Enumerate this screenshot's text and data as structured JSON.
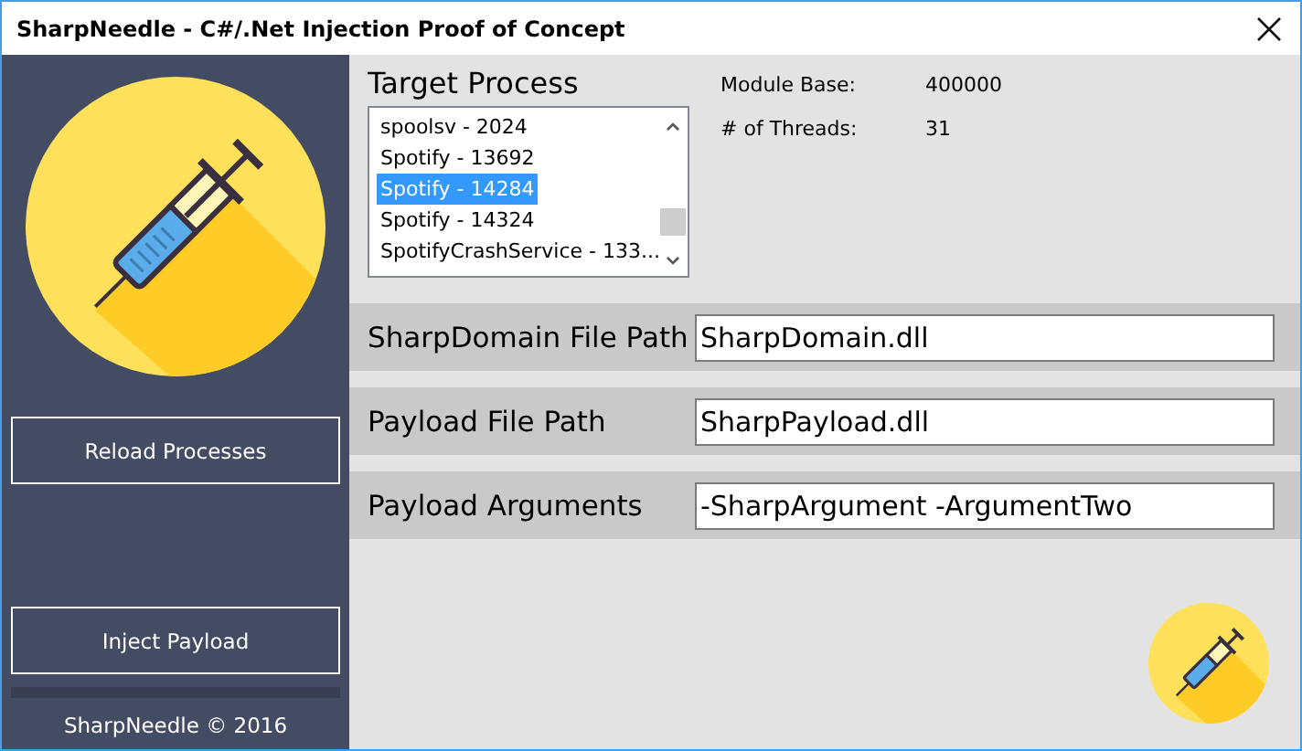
{
  "window": {
    "title": "SharpNeedle - C#/.Net Injection Proof of Concept"
  },
  "sidebar": {
    "buttons": [
      "Reload Processes",
      "Inject Payload"
    ],
    "progress": {
      "level": 0
    },
    "footer": "SharpNeedle © 2016"
  },
  "target_process": {
    "label": "Target Process",
    "items": [
      {
        "text": "spoolsv - 2024",
        "selected": false
      },
      {
        "text": "Spotify - 13692",
        "selected": false
      },
      {
        "text": "Spotify - 14284",
        "selected": true
      },
      {
        "text": "Spotify - 14324",
        "selected": false
      },
      {
        "text": "SpotifyCrashService - 133...",
        "selected": false
      }
    ]
  },
  "info": [
    {
      "label": "Module Base:",
      "value": "400000"
    },
    {
      "label": "# of Threads:",
      "value": "31"
    }
  ],
  "fields": [
    {
      "label": "SharpDomain File Path",
      "value": "SharpDomain.dll"
    },
    {
      "label": "Payload File Path",
      "value": "SharpPayload.dll"
    },
    {
      "label": "Payload Arguments",
      "value": "-SharpArgument -ArgumentTwo"
    }
  ]
}
